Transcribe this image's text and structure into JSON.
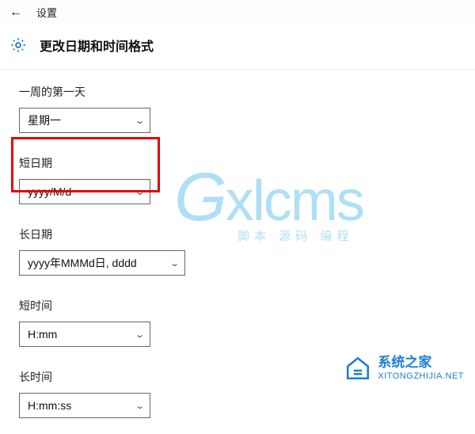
{
  "titlebar": {
    "label": "设置"
  },
  "header": {
    "title": "更改日期和时间格式"
  },
  "fields": {
    "first_day": {
      "label": "一周的第一天",
      "value": "星期一"
    },
    "short_date": {
      "label": "短日期",
      "value": "yyyy/M/d"
    },
    "long_date": {
      "label": "长日期",
      "value": "yyyy年MMMd日, dddd"
    },
    "short_time": {
      "label": "短时间",
      "value": "H:mm"
    },
    "long_time": {
      "label": "长时间",
      "value": "H:mm:ss"
    }
  },
  "watermarks": {
    "gx_text": "Gxlcms",
    "gx_sub": "脚本 源码 编程",
    "sys_cn": "系统之家",
    "sys_url": "XITONGZHIJIA.NET"
  }
}
